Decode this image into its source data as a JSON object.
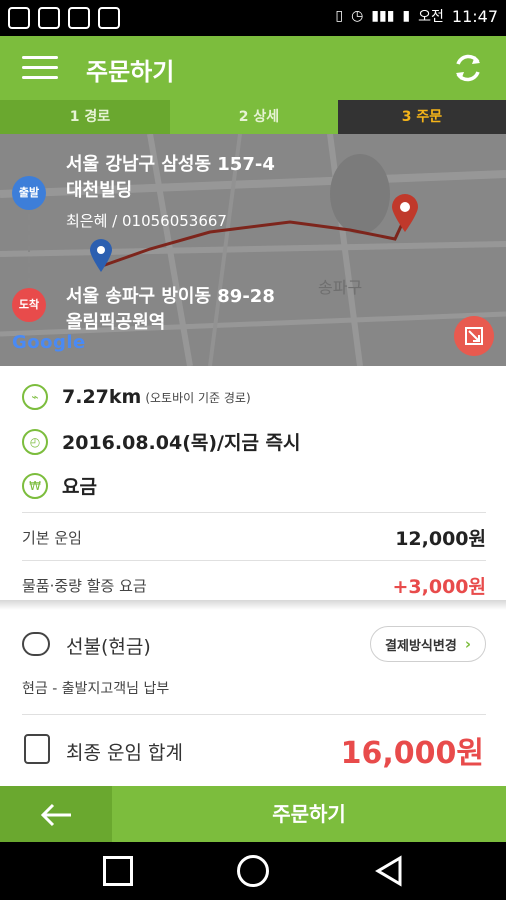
{
  "status_bar": {
    "time": "11:47",
    "ampm": "오전"
  },
  "header": {
    "title": "주문하기",
    "menu_icon": "hamburger-icon",
    "refresh_icon": "refresh-icon"
  },
  "steps": [
    {
      "label": "1 경로",
      "state": "done"
    },
    {
      "label": "2 상세",
      "state": "done"
    },
    {
      "label": "3 주문",
      "state": "active"
    }
  ],
  "map": {
    "start_badge": "출발",
    "end_badge": "도착",
    "start_address_line1": "서울 강남구 삼성동 157-4",
    "start_address_line2": "대천빌딩",
    "start_contact": "최은혜 / 01056053667",
    "end_address_line1": "서울 송파구 방이동 89-28",
    "end_address_line2": "올림픽공원역",
    "area_label": "송파구",
    "google_logo": "Google"
  },
  "info": {
    "distance": "7.27km",
    "distance_note": "(오토바이 기준 경로)",
    "datetime": "2016.08.04(목)/지금 즉시",
    "fee_title": "요금",
    "fees": [
      {
        "label": "기본 운임",
        "value": "12,000원",
        "color": "#222222"
      },
      {
        "label": "물품·중량 할증 요금",
        "value": "+3,000원",
        "color": "#e84b4b"
      }
    ]
  },
  "payment": {
    "title": "선불(현금)",
    "change_button": "결제방식변경",
    "description": "현금 - 출발지고객님 납부"
  },
  "total": {
    "label": "최종 운임 합계",
    "value": "16,000원"
  },
  "bottom": {
    "back_icon": "arrow-left-icon",
    "order_button": "주문하기"
  },
  "colors": {
    "accent": "#7cbd3d",
    "accent_dark": "#6aa82f",
    "alert": "#e84b4b",
    "step_active": "#f5b419"
  }
}
